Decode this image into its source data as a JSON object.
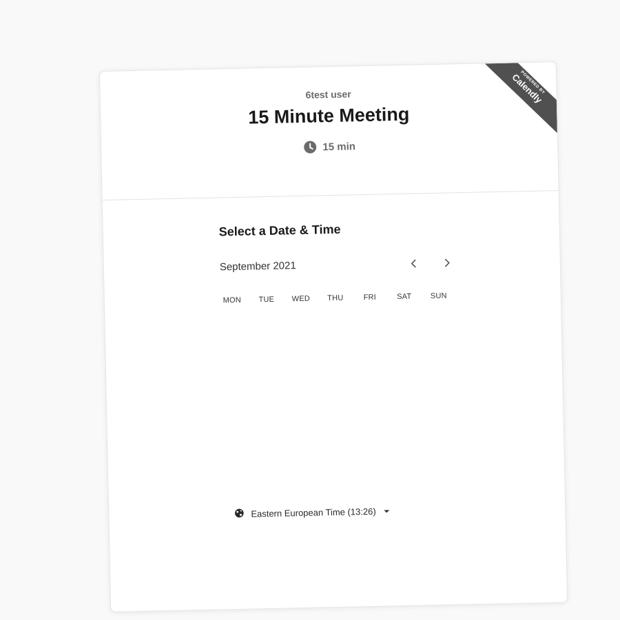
{
  "header": {
    "owner": "6test user",
    "title": "15 Minute Meeting",
    "duration": "15 min"
  },
  "badge": {
    "powered_by": "POWERED BY",
    "brand": "Calendly",
    "color": "#505050"
  },
  "scheduler": {
    "heading": "Select a Date & Time",
    "month": "September 2021",
    "prev_icon": "chevron-left-icon",
    "next_icon": "chevron-right-icon",
    "weekdays": [
      "MON",
      "TUE",
      "WED",
      "THU",
      "FRI",
      "SAT",
      "SUN"
    ]
  },
  "timezone": {
    "icon": "globe-icon",
    "label": "Eastern European Time (13:26)"
  }
}
